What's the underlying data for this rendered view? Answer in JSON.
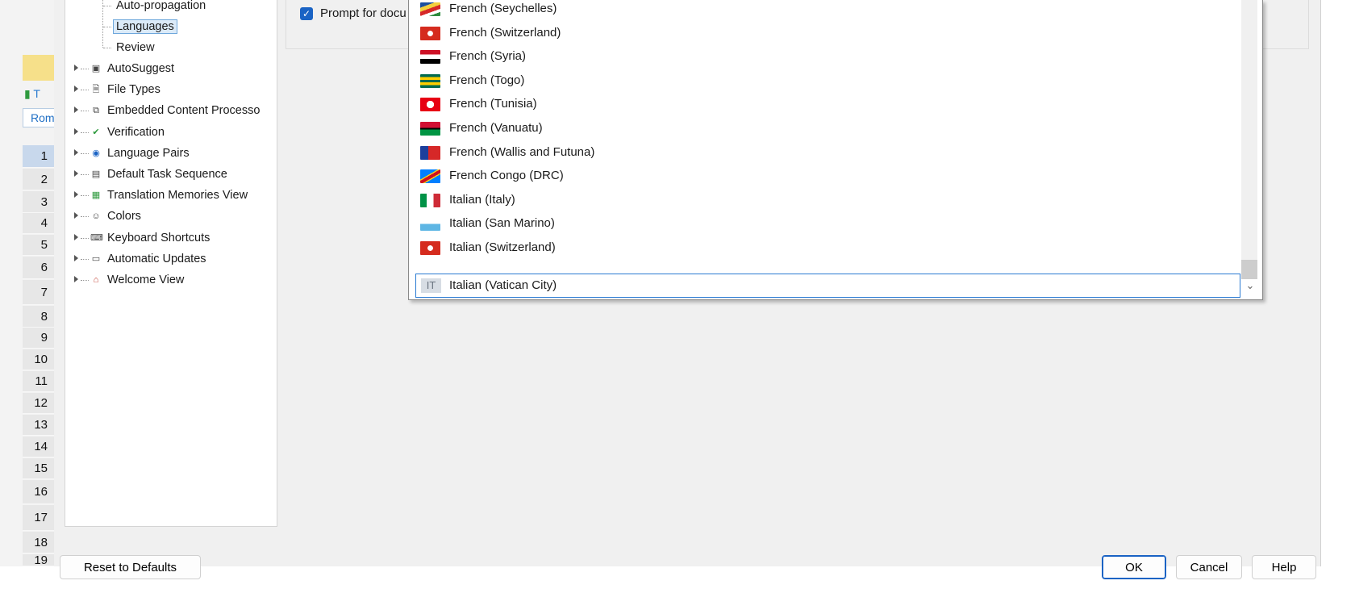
{
  "background_app": {
    "tab_short": "T",
    "tab_label": "Rom",
    "row_numbers": [
      "1",
      "2",
      "3",
      "4",
      "5",
      "6",
      "7",
      "8",
      "9",
      "10",
      "11",
      "12",
      "13",
      "14",
      "15",
      "16",
      "17",
      "18",
      "19"
    ]
  },
  "tree": {
    "items": [
      {
        "label": "Auto-propagation",
        "icon": "none",
        "child": true
      },
      {
        "label": "Languages",
        "icon": "none",
        "child": true,
        "selected": true
      },
      {
        "label": "Review",
        "icon": "none",
        "child": true
      },
      {
        "label": "AutoSuggest",
        "icon": "autosuggest-icon"
      },
      {
        "label": "File Types",
        "icon": "file-types-icon"
      },
      {
        "label": "Embedded Content Processo",
        "icon": "embedded-content-icon"
      },
      {
        "label": "Verification",
        "icon": "verification-icon"
      },
      {
        "label": "Language Pairs",
        "icon": "language-pairs-icon"
      },
      {
        "label": "Default Task Sequence",
        "icon": "task-sequence-icon"
      },
      {
        "label": "Translation Memories View",
        "icon": "translation-memories-icon"
      },
      {
        "label": "Colors",
        "icon": "palette-icon"
      },
      {
        "label": "Keyboard Shortcuts",
        "icon": "keyboard-icon"
      },
      {
        "label": "Automatic Updates",
        "icon": "updates-icon"
      },
      {
        "label": "Welcome View",
        "icon": "home-icon"
      }
    ]
  },
  "panel": {
    "checkbox_label": "Prompt for docu",
    "checkbox_checked": true
  },
  "dropdown": {
    "items": [
      {
        "label": "French (Seychelles)",
        "flag": "seychelles"
      },
      {
        "label": "French (Switzerland)",
        "flag": "switzerland"
      },
      {
        "label": "French (Syria)",
        "flag": "syria"
      },
      {
        "label": "French (Togo)",
        "flag": "togo"
      },
      {
        "label": "French (Tunisia)",
        "flag": "tunisia"
      },
      {
        "label": "French (Vanuatu)",
        "flag": "vanuatu"
      },
      {
        "label": "French (Wallis and Futuna)",
        "flag": "wallis-futuna"
      },
      {
        "label": "French Congo (DRC)",
        "flag": "drc"
      },
      {
        "label": "Italian (Italy)",
        "flag": "italy"
      },
      {
        "label": "Italian (San Marino)",
        "flag": "san-marino"
      },
      {
        "label": "Italian (Switzerland)",
        "flag": "switzerland"
      }
    ],
    "selected": {
      "label": "Italian (Vatican City)",
      "flag_text": "IT"
    }
  },
  "buttons": {
    "reset": "Reset to Defaults",
    "ok": "OK",
    "cancel": "Cancel",
    "help": "Help"
  },
  "colors": {
    "accent": "#1a63c4",
    "selection_bg": "#dbeaf8",
    "dialog_bg": "#f0f0f0"
  }
}
